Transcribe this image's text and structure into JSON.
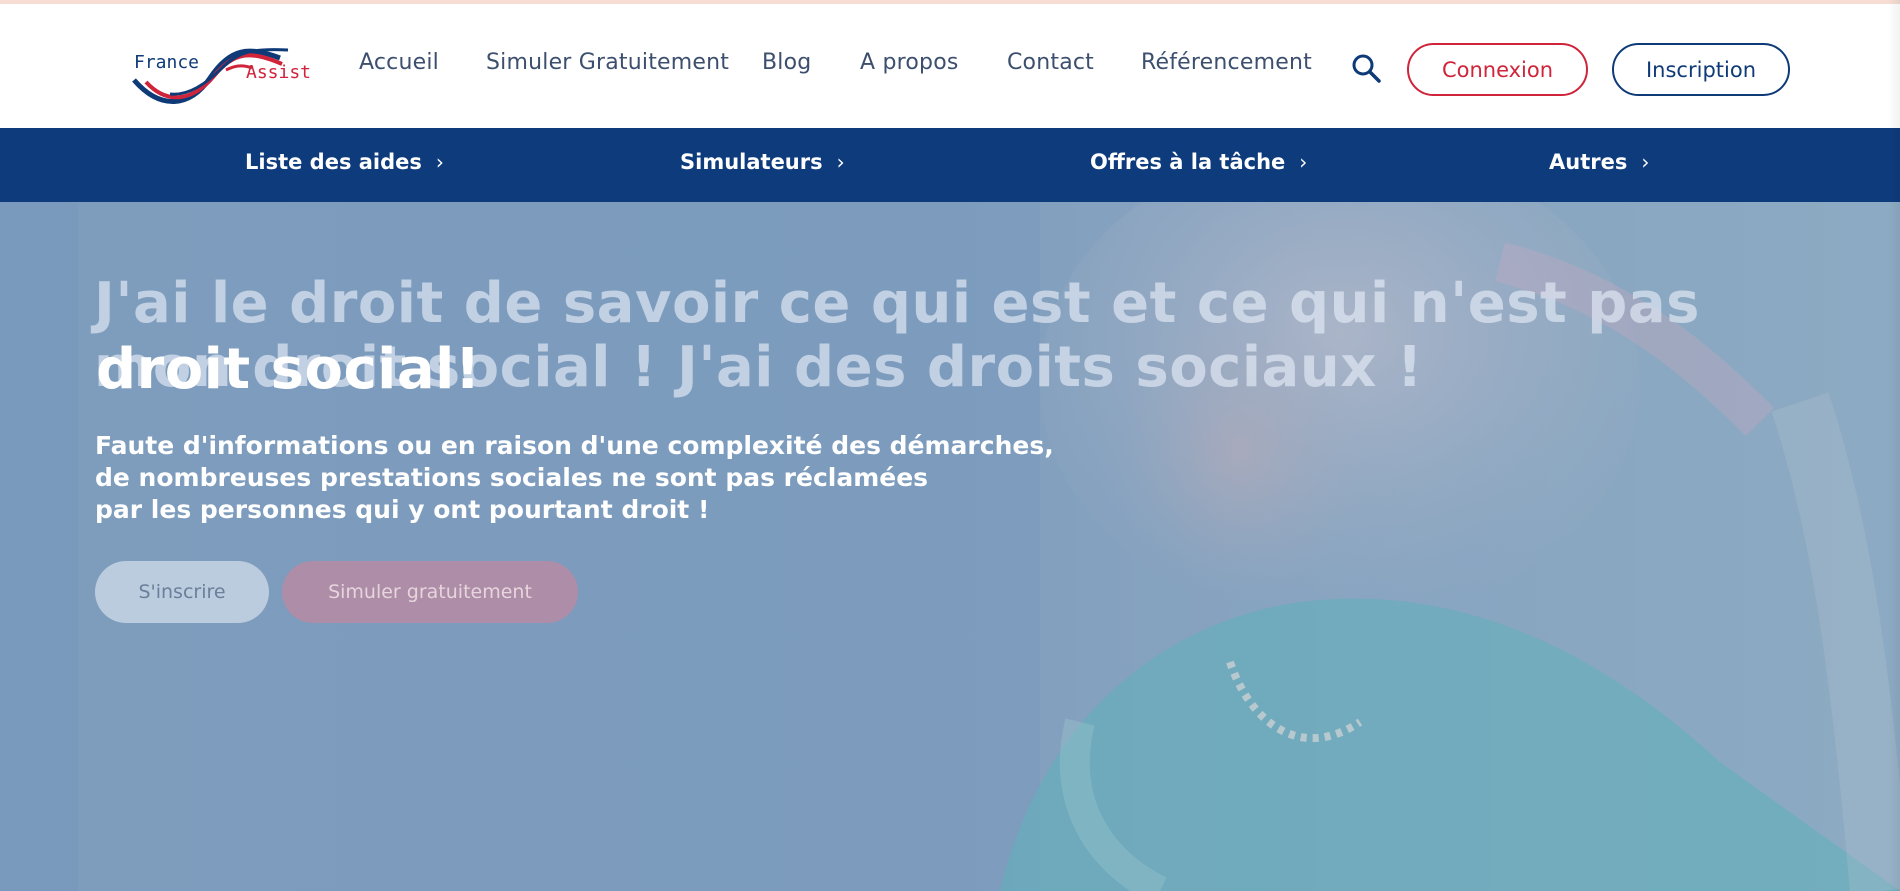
{
  "logo": {
    "text_france": "France",
    "text_assist": "Assist"
  },
  "nav": {
    "links": [
      "Accueil",
      "Simuler Gratuitement",
      "Blog",
      "A propos",
      "Contact",
      "Référencement"
    ],
    "search_icon": "search-icon",
    "login_label": "Connexion",
    "signup_label": "Inscription"
  },
  "subnav": {
    "items": [
      {
        "label": "Liste des aides",
        "icon": "chevron-right-icon"
      },
      {
        "label": "Simulateurs",
        "icon": "chevron-right-icon"
      },
      {
        "label": "Offres à la tâche",
        "icon": "chevron-right-icon"
      },
      {
        "label": "Autres",
        "icon": "chevron-right-icon"
      }
    ],
    "chevron": "›"
  },
  "hero": {
    "headline_ghost": "J'ai le droit de savoir ce qui est et ce qui n'est pas mon droit social ! J'ai des droits sociaux !",
    "headline_front": "droit social!",
    "subtitle_lines": [
      "Faute d'informations ou en raison d'une complexité des démarches,",
      "de nombreuses prestations sociales ne sont pas réclamées",
      "par les personnes qui y ont pourtant droit !"
    ],
    "cta_primary": "S'inscrire",
    "cta_secondary": "Simuler gratuitement"
  },
  "colors": {
    "brand_blue": "#0e3b7c",
    "brand_red": "#d0243a",
    "nav_text": "#3d4f6e",
    "hero_overlay": "#7e9dbd"
  }
}
